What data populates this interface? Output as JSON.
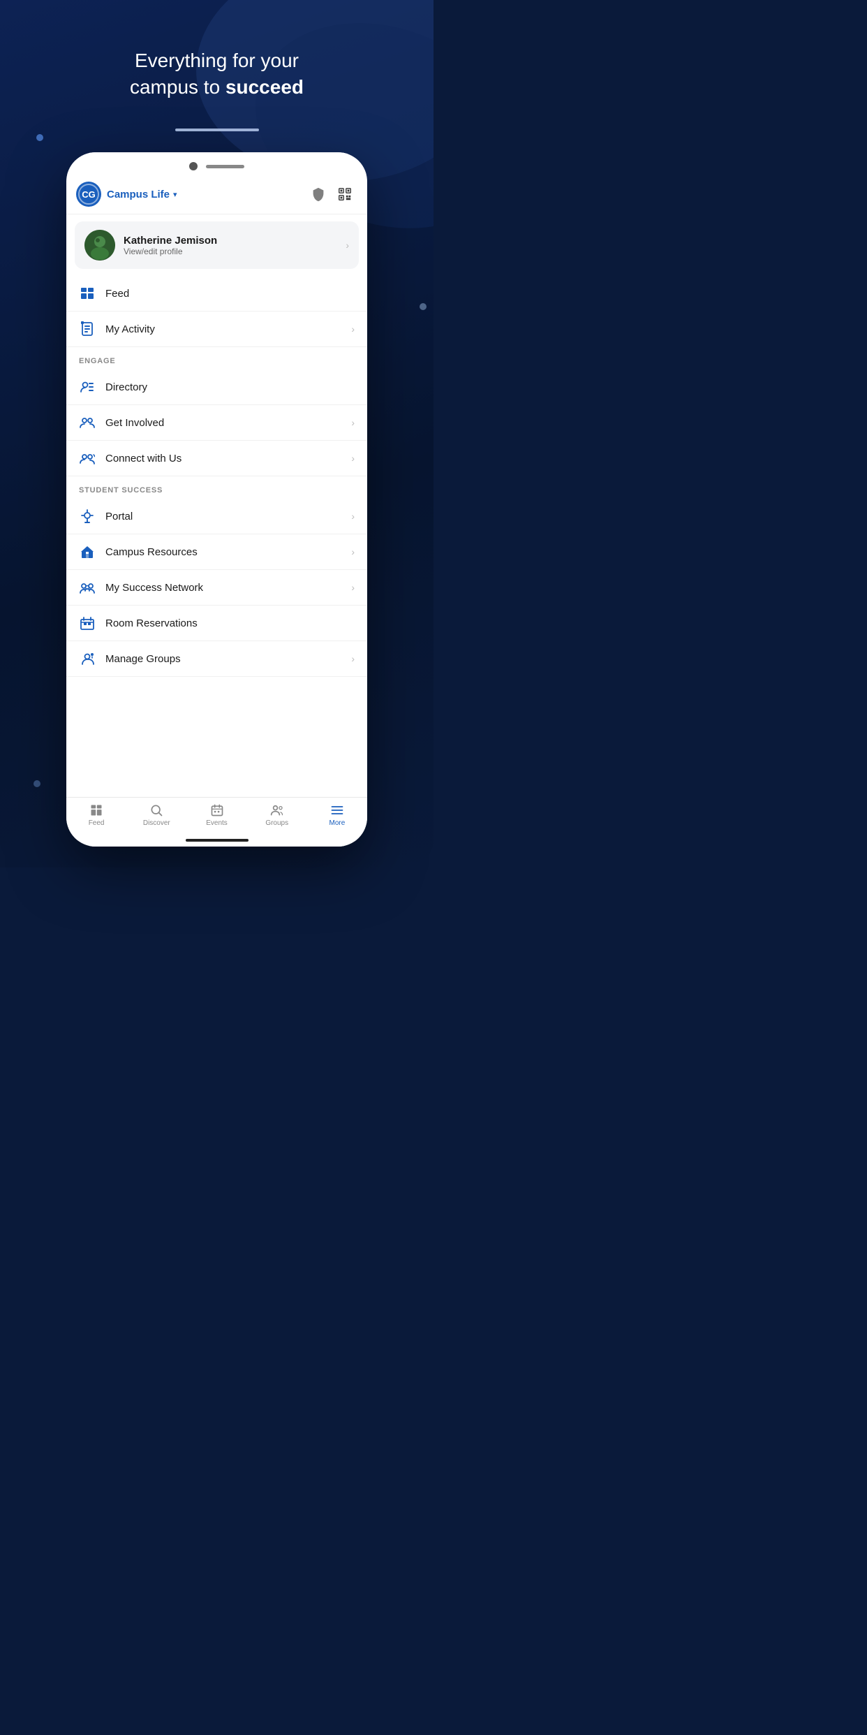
{
  "background": {
    "headline_part1": "Everything for your",
    "headline_part2": "campus to ",
    "headline_bold": "succeed"
  },
  "app": {
    "logo_initials": "CG",
    "title": "Campus Life",
    "title_chevron": "▾",
    "profile": {
      "name": "Katherine Jemison",
      "subtitle": "View/edit profile",
      "avatar_emoji": "👩"
    },
    "nav_items": [
      {
        "id": "feed",
        "label": "Feed",
        "icon": "feed"
      },
      {
        "id": "my-activity",
        "label": "My Activity",
        "icon": "activity"
      }
    ],
    "engage_section_label": "ENGAGE",
    "engage_items": [
      {
        "id": "directory",
        "label": "Directory",
        "icon": "directory",
        "has_chevron": false
      },
      {
        "id": "get-involved",
        "label": "Get Involved",
        "icon": "get-involved",
        "has_chevron": true
      },
      {
        "id": "connect-with-us",
        "label": "Connect with Us",
        "icon": "connect",
        "has_chevron": true
      }
    ],
    "student_success_section_label": "STUDENT SUCCESS",
    "student_success_items": [
      {
        "id": "portal",
        "label": "Portal",
        "icon": "portal",
        "has_chevron": true
      },
      {
        "id": "campus-resources",
        "label": "Campus Resources",
        "icon": "campus-resources",
        "has_chevron": true
      },
      {
        "id": "my-success-network",
        "label": "My Success Network",
        "icon": "success-network",
        "has_chevron": true
      },
      {
        "id": "room-reservations",
        "label": "Room Reservations",
        "icon": "room-reservations",
        "has_chevron": false
      },
      {
        "id": "manage-groups",
        "label": "Manage Groups",
        "icon": "manage-groups",
        "has_chevron": true
      }
    ],
    "bottom_nav": [
      {
        "id": "feed-tab",
        "label": "Feed",
        "icon": "feed",
        "active": false
      },
      {
        "id": "discover-tab",
        "label": "Discover",
        "icon": "discover",
        "active": false
      },
      {
        "id": "events-tab",
        "label": "Events",
        "icon": "events",
        "active": false
      },
      {
        "id": "groups-tab",
        "label": "Groups",
        "icon": "groups",
        "active": false
      },
      {
        "id": "more-tab",
        "label": "More",
        "icon": "more",
        "active": true
      }
    ]
  }
}
